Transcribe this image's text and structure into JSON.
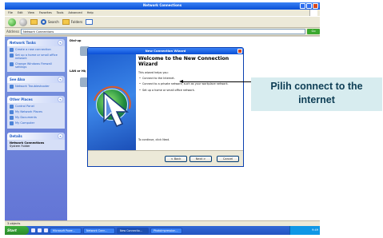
{
  "window": {
    "title": "Network Connections"
  },
  "menubar": {
    "items": [
      "File",
      "Edit",
      "View",
      "Favorites",
      "Tools",
      "Advanced",
      "Help"
    ]
  },
  "toolbar": {
    "search_label": "Search",
    "folders_label": "Folders"
  },
  "addressbar": {
    "label": "Address",
    "value": "Network Connections",
    "go_label": "Go"
  },
  "leftpane": {
    "network_tasks": {
      "title": "Network Tasks",
      "items": [
        "Create a new connection",
        "Set up a home or small office network",
        "Change Windows Firewall settings"
      ]
    },
    "see_also": {
      "title": "See Also",
      "items": [
        "Network Troubleshooter"
      ]
    },
    "other_places": {
      "title": "Other Places",
      "items": [
        "Control Panel",
        "My Network Places",
        "My Documents",
        "My Computer"
      ]
    },
    "details": {
      "title": "Details",
      "name": "Network Connections",
      "type": "System Folder"
    }
  },
  "main": {
    "group1": "Dial-up",
    "group2": "LAN or High-Speed Internet"
  },
  "wizard": {
    "title": "New Connection Wizard",
    "heading": "Welcome to the New Connection Wizard",
    "intro": "This wizard helps you:",
    "bullets": [
      "Connect to the Internet.",
      "Connect to a private network, such as your workplace network.",
      "Set up a home or small office network."
    ],
    "continue_text": "To continue, click Next.",
    "buttons": {
      "back": "< Back",
      "next": "Next >",
      "cancel": "Cancel"
    }
  },
  "statusbar": {
    "text": "3 objects"
  },
  "taskbar": {
    "start_label": "Start",
    "tasks": [
      "Microsoft Powe...",
      "Network Conn...",
      "New Connectio...",
      "Photoimpression..."
    ],
    "clock": "9:49"
  },
  "callout": {
    "text": "Pilih connect to the internet"
  },
  "colors": {
    "xp_blue": "#0a4fd6",
    "task_pane": "#6375d6",
    "callout_bg": "#d7ecef",
    "callout_text": "#0e3e55"
  }
}
